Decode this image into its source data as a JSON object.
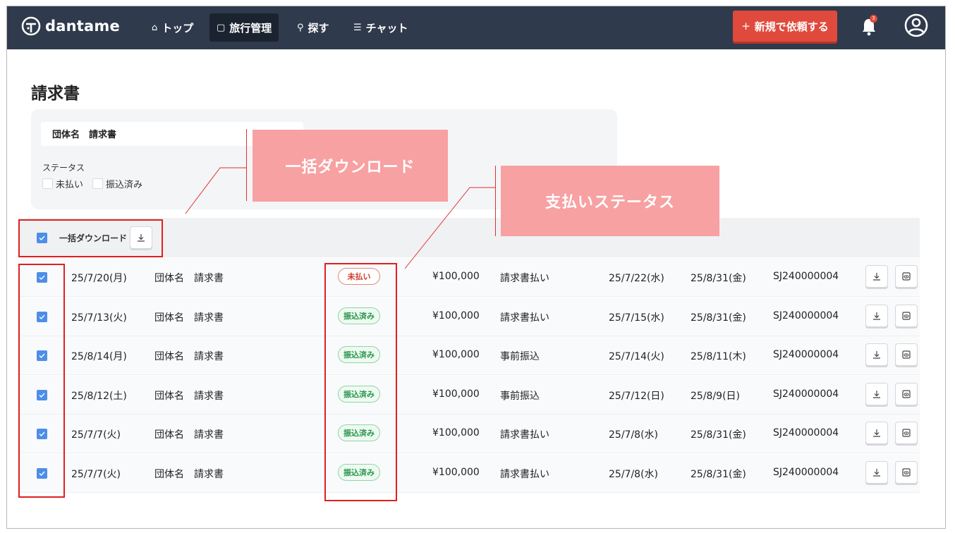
{
  "nav": {
    "brand": "dantame",
    "items": [
      {
        "label": "トップ",
        "icon": "home-icon",
        "glyph": "⌂"
      },
      {
        "label": "旅行管理",
        "icon": "travel-icon",
        "glyph": "▢"
      },
      {
        "label": "探す",
        "icon": "search-icon",
        "glyph": "⚲"
      },
      {
        "label": "チャット",
        "icon": "chat-icon",
        "glyph": "☰"
      }
    ],
    "new_request_label": "新規で依頼する",
    "notification_count": "3"
  },
  "page": {
    "title": "請求書"
  },
  "filters": {
    "search_value": "団体名　請求書",
    "status_label": "ステータス",
    "options": [
      "未払い",
      "振込済み"
    ]
  },
  "bulk": {
    "label": "一括ダウンロード"
  },
  "rows": [
    {
      "date": "25/7/20(月)",
      "name": "団体名　請求書",
      "status": "未払い",
      "status_type": "unpaid",
      "amount": "¥100,000",
      "method": "請求書払い",
      "issue": "25/7/22(水)",
      "due": "25/8/31(金)",
      "code": "SJ240000004"
    },
    {
      "date": "25/7/13(火)",
      "name": "団体名　請求書",
      "status": "振込済み",
      "status_type": "paid",
      "amount": "¥100,000",
      "method": "請求書払い",
      "issue": "25/7/15(水)",
      "due": "25/8/31(金)",
      "code": "SJ240000004"
    },
    {
      "date": "25/8/14(月)",
      "name": "団体名　請求書",
      "status": "振込済み",
      "status_type": "paid",
      "amount": "¥100,000",
      "method": "事前振込",
      "issue": "25/7/14(火)",
      "due": "25/8/11(木)",
      "code": "SJ240000004"
    },
    {
      "date": "25/8/12(土)",
      "name": "団体名　請求書",
      "status": "振込済み",
      "status_type": "paid",
      "amount": "¥100,000",
      "method": "事前振込",
      "issue": "25/7/12(日)",
      "due": "25/8/9(日)",
      "code": "SJ240000004"
    },
    {
      "date": "25/7/7(火)",
      "name": "団体名　請求書",
      "status": "振込済み",
      "status_type": "paid",
      "amount": "¥100,000",
      "method": "請求書払い",
      "issue": "25/7/8(水)",
      "due": "25/8/31(金)",
      "code": "SJ240000004"
    },
    {
      "date": "25/7/7(火)",
      "name": "団体名　請求書",
      "status": "振込済み",
      "status_type": "paid",
      "amount": "¥100,000",
      "method": "請求書払い",
      "issue": "25/7/8(水)",
      "due": "25/8/31(金)",
      "code": "SJ240000004"
    }
  ],
  "annotations": {
    "bulk_download": "一括ダウンロード",
    "payment_status": "支払いステータス"
  },
  "colors": {
    "nav_bg": "#2f3a4c",
    "accent": "#e04a3c",
    "checkbox": "#4d8ee8",
    "annotation": "#f7a1a2",
    "highlight": "#e01f1f"
  }
}
